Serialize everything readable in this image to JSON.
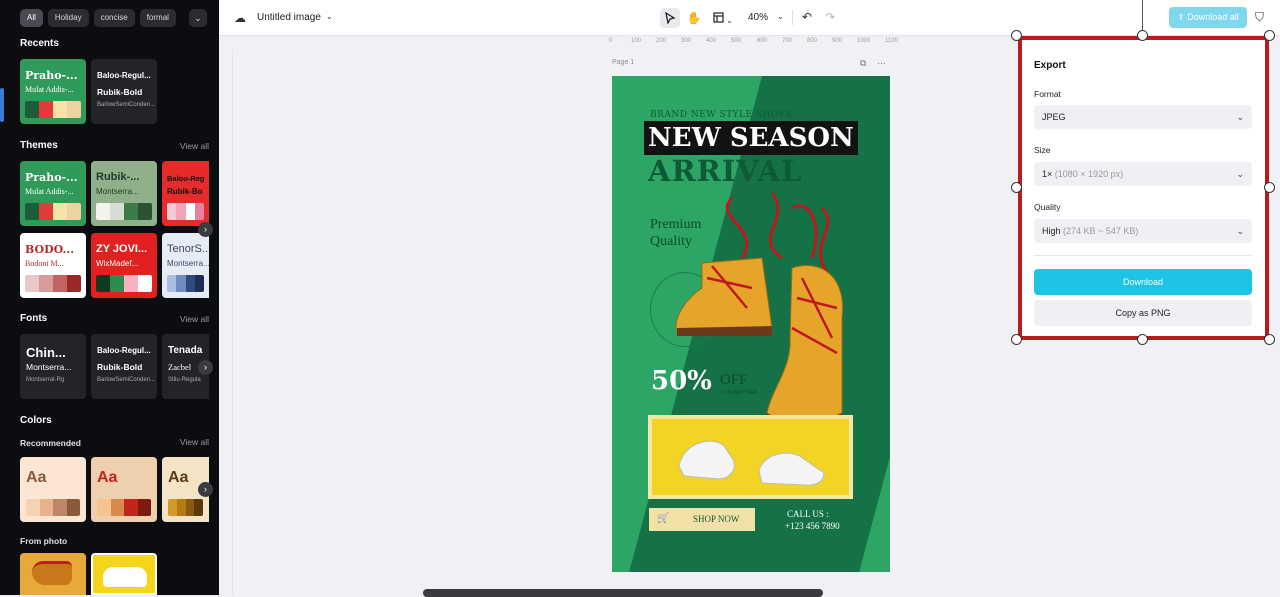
{
  "sidebar": {
    "chips": [
      "All",
      "Holiday",
      "concise",
      "formal",
      "⌄"
    ],
    "recents_title": "Recents",
    "recents": [
      {
        "t1": "Praho-...",
        "t2": "Mulat Addis-...",
        "bg": "#2f9a59",
        "fg": "#ffffff",
        "swatches": [
          "#1f5c3b",
          "#e23b3b",
          "#f6e3a8",
          "#ead4a0"
        ]
      },
      {
        "font1": "Baloo-Regul...",
        "font2": "Rubik-Bold",
        "font3": "BarlowSemiConden..."
      }
    ],
    "themes_title": "Themes",
    "themes_view_all": "View all",
    "themes": [
      {
        "t1": "Praho-...",
        "t2": "Mulat Addis-...",
        "bg": "#2f9a59",
        "fg": "#ffffff",
        "swatches": [
          "#1f5c3b",
          "#e23b3b",
          "#f6e3a8",
          "#ead4a0"
        ]
      },
      {
        "t1": "Rubik-...",
        "t2": "Montserra...",
        "bg": "#8fb08a",
        "fg": "#1e3a23",
        "swatches": [
          "#f2f2ee",
          "#d8ddd4",
          "#3c7a47",
          "#2a5233"
        ]
      },
      {
        "t1": "Baloo-Reg",
        "t2": "Rubik-Bo",
        "bg": "#e52b2b",
        "fg": "#111111",
        "swatches": [
          "#f7c9d1",
          "#f3a3b6",
          "#ffffff",
          "#e880a0"
        ]
      },
      {
        "t1": "BODO...",
        "t2": "Bodoni M...",
        "bg": "#ffffff",
        "fg": "#b62a2a",
        "swatches": [
          "#e8c8c8",
          "#d89a9a",
          "#c26464",
          "#9a2a2a"
        ]
      },
      {
        "t1": "ZY JOVI...",
        "t2": "WixMadef...",
        "bg": "#e12020",
        "fg": "#ffffff",
        "swatches": [
          "#113a22",
          "#2f8c4e",
          "#f7b2c0",
          "#ffffff"
        ]
      },
      {
        "t1": "TenorS...",
        "t2": "Montserra...",
        "bg": "#e5ecf5",
        "fg": "#3a4a66",
        "swatches": [
          "#a8bde0",
          "#6f8cc0",
          "#2f4a80",
          "#1c2e54"
        ]
      }
    ],
    "fonts_title": "Fonts",
    "fonts_view_all": "View all",
    "fonts": [
      {
        "f1": "Chin...",
        "f2": "Montserra...",
        "f3": "Montserrat-Rg"
      },
      {
        "f1": "Baloo-Regul...",
        "f2": "Rubik-Bold",
        "f3": "BarlowSemiConden..."
      },
      {
        "f1": "Tenada",
        "f2": "Zacbel",
        "f3": "Stilu-Regula"
      }
    ],
    "colors_title": "Colors",
    "recommended_title": "Recommended",
    "colors_view_all": "View all",
    "colors": [
      {
        "aa": "Aa",
        "bg": "#fbe6d4",
        "fg": "#8a5a3a",
        "swatches": [
          "#f6d2b5",
          "#e8b38c",
          "#c08566",
          "#8a5a3a"
        ]
      },
      {
        "aa": "Aa",
        "bg": "#eecfae",
        "fg": "#c0261a",
        "swatches": [
          "#f7c48f",
          "#d88a4a",
          "#c0261a",
          "#7a1a10"
        ]
      },
      {
        "aa": "Aa",
        "bg": "#f5e3c6",
        "fg": "#5a3a1a",
        "swatches": [
          "#d39a2a",
          "#b77b14",
          "#8a5a10",
          "#5a3a08"
        ]
      }
    ],
    "from_photo_title": "From photo"
  },
  "topbar": {
    "doc_title": "Untitled image",
    "zoom": "40%",
    "download_all": "Download all"
  },
  "ruler_h": [
    "0",
    "100",
    "200",
    "300",
    "400",
    "500",
    "600",
    "700",
    "800",
    "900",
    "1000",
    "1100"
  ],
  "canvas": {
    "page_label": "Page 1",
    "brand": "BRAND NEW STYLE SHOES",
    "headline1": "NEW SEASON",
    "headline2": "ARRIVAL",
    "premium": "Premium Quality",
    "discount": "50%",
    "off": "OFF",
    "off_sub": "FOR ANY ITEM",
    "shop_now": "SHOP NOW",
    "call_us": "CALL US :",
    "phone": "+123 456 7890"
  },
  "export": {
    "title": "Export",
    "format_label": "Format",
    "format_value": "JPEG",
    "size_label": "Size",
    "size_value": "1×",
    "size_detail": "(1080 × 1920 px)",
    "quality_label": "Quality",
    "quality_value": "High",
    "quality_detail": "(274 KB ~ 547 KB)",
    "download": "Download",
    "copy_png": "Copy as PNG"
  },
  "colors": {
    "accent": "#1fc3e3",
    "selection": "#b51d1d",
    "poster_green": "#2da665"
  }
}
